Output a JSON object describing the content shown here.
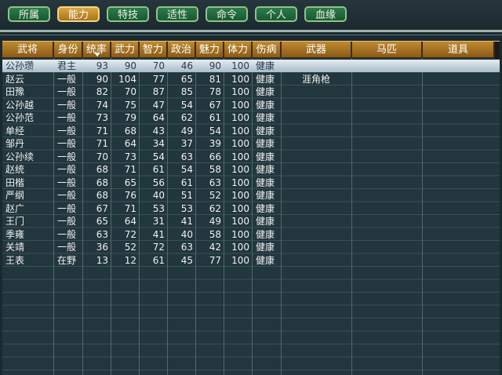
{
  "tabs": [
    {
      "label": "所属",
      "active": false
    },
    {
      "label": "能力",
      "active": true
    },
    {
      "label": "特技",
      "active": false
    },
    {
      "label": "适性",
      "active": false
    },
    {
      "label": "命令",
      "active": false
    },
    {
      "label": "个人",
      "active": false
    },
    {
      "label": "血缘",
      "active": false
    }
  ],
  "columns": {
    "name": "武将",
    "status": "身份",
    "lead": "统率",
    "war": "武力",
    "int": "智力",
    "pol": "政治",
    "chr": "魅力",
    "hp": "体力",
    "injury": "伤病",
    "weapon": "武器",
    "horse": "马匹",
    "item": "道具"
  },
  "rows": [
    {
      "name": "公孙瓒",
      "status": "君主",
      "lead": "93",
      "war": "90",
      "int": "70",
      "pol": "46",
      "chr": "90",
      "hp": "100",
      "injury": "健康",
      "weapon": "",
      "horse": "",
      "item": "",
      "selected": true
    },
    {
      "name": "赵云",
      "status": "一般",
      "lead": "90",
      "war": "104",
      "int": "77",
      "pol": "65",
      "chr": "81",
      "hp": "100",
      "injury": "健康",
      "weapon": "涯角枪",
      "horse": "",
      "item": ""
    },
    {
      "name": "田豫",
      "status": "一般",
      "lead": "82",
      "war": "70",
      "int": "87",
      "pol": "85",
      "chr": "78",
      "hp": "100",
      "injury": "健康",
      "weapon": "",
      "horse": "",
      "item": ""
    },
    {
      "name": "公孙越",
      "status": "一般",
      "lead": "74",
      "war": "75",
      "int": "47",
      "pol": "54",
      "chr": "67",
      "hp": "100",
      "injury": "健康",
      "weapon": "",
      "horse": "",
      "item": ""
    },
    {
      "name": "公孙范",
      "status": "一般",
      "lead": "73",
      "war": "79",
      "int": "64",
      "pol": "62",
      "chr": "61",
      "hp": "100",
      "injury": "健康",
      "weapon": "",
      "horse": "",
      "item": ""
    },
    {
      "name": "单经",
      "status": "一般",
      "lead": "71",
      "war": "68",
      "int": "43",
      "pol": "49",
      "chr": "54",
      "hp": "100",
      "injury": "健康",
      "weapon": "",
      "horse": "",
      "item": ""
    },
    {
      "name": "邹丹",
      "status": "一般",
      "lead": "71",
      "war": "64",
      "int": "34",
      "pol": "37",
      "chr": "39",
      "hp": "100",
      "injury": "健康",
      "weapon": "",
      "horse": "",
      "item": ""
    },
    {
      "name": "公孙续",
      "status": "一般",
      "lead": "70",
      "war": "73",
      "int": "54",
      "pol": "63",
      "chr": "66",
      "hp": "100",
      "injury": "健康",
      "weapon": "",
      "horse": "",
      "item": ""
    },
    {
      "name": "赵统",
      "status": "一般",
      "lead": "68",
      "war": "71",
      "int": "61",
      "pol": "54",
      "chr": "58",
      "hp": "100",
      "injury": "健康",
      "weapon": "",
      "horse": "",
      "item": ""
    },
    {
      "name": "田楷",
      "status": "一般",
      "lead": "68",
      "war": "65",
      "int": "56",
      "pol": "61",
      "chr": "63",
      "hp": "100",
      "injury": "健康",
      "weapon": "",
      "horse": "",
      "item": ""
    },
    {
      "name": "严纲",
      "status": "一般",
      "lead": "68",
      "war": "76",
      "int": "40",
      "pol": "51",
      "chr": "52",
      "hp": "100",
      "injury": "健康",
      "weapon": "",
      "horse": "",
      "item": ""
    },
    {
      "name": "赵广",
      "status": "一般",
      "lead": "67",
      "war": "71",
      "int": "53",
      "pol": "53",
      "chr": "62",
      "hp": "100",
      "injury": "健康",
      "weapon": "",
      "horse": "",
      "item": ""
    },
    {
      "name": "王门",
      "status": "一般",
      "lead": "65",
      "war": "64",
      "int": "31",
      "pol": "41",
      "chr": "49",
      "hp": "100",
      "injury": "健康",
      "weapon": "",
      "horse": "",
      "item": ""
    },
    {
      "name": "季雍",
      "status": "一般",
      "lead": "63",
      "war": "72",
      "int": "41",
      "pol": "40",
      "chr": "58",
      "hp": "100",
      "injury": "健康",
      "weapon": "",
      "horse": "",
      "item": ""
    },
    {
      "name": "关靖",
      "status": "一般",
      "lead": "36",
      "war": "52",
      "int": "72",
      "pol": "63",
      "chr": "42",
      "hp": "100",
      "injury": "健康",
      "weapon": "",
      "horse": "",
      "item": ""
    },
    {
      "name": "王表",
      "status": "在野",
      "lead": "13",
      "war": "12",
      "int": "61",
      "pol": "45",
      "chr": "77",
      "hp": "100",
      "injury": "健康",
      "weapon": "",
      "horse": "",
      "item": ""
    }
  ],
  "colors": {
    "active_tab": "#c08a30",
    "tab": "#1f6a3c",
    "header": "#a87424",
    "selected_row": "#c8d6e2"
  }
}
